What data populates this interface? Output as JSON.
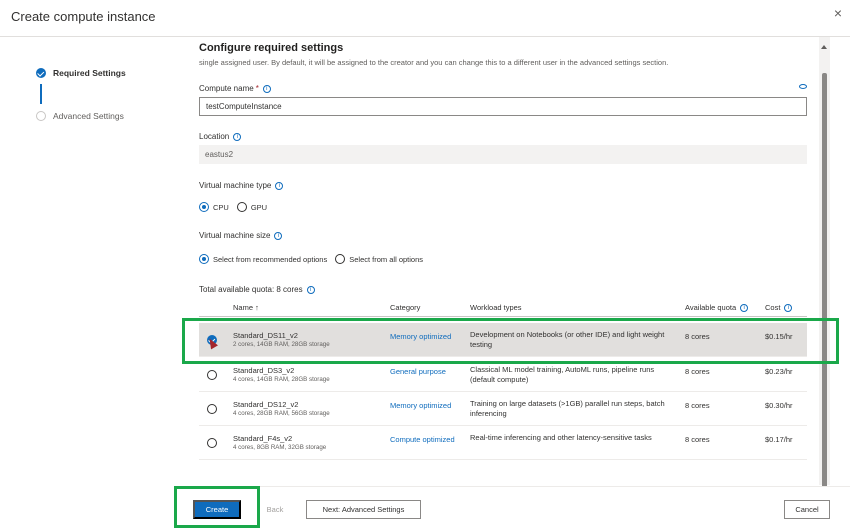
{
  "window": {
    "title": "Create compute instance",
    "close_icon": "×"
  },
  "steps": [
    {
      "label": "Required Settings",
      "state": "done"
    },
    {
      "label": "Advanced Settings",
      "state": "pending"
    }
  ],
  "section": {
    "heading": "Configure required settings",
    "intro": "single assigned user. By default, it will be assigned to the creator and you can change this to a different user in the advanced settings section."
  },
  "compute_name": {
    "label": "Compute name",
    "required_marker": "*",
    "value": "testComputeInstance"
  },
  "location": {
    "label": "Location",
    "value": "eastus2"
  },
  "vm_type": {
    "label": "Virtual machine type",
    "options": [
      {
        "label": "CPU",
        "selected": true
      },
      {
        "label": "GPU",
        "selected": false
      }
    ]
  },
  "vm_size": {
    "label": "Virtual machine size",
    "options": [
      {
        "label": "Select from recommended options",
        "selected": true
      },
      {
        "label": "Select from all options",
        "selected": false
      }
    ]
  },
  "quota": {
    "label": "Total available quota: 8 cores"
  },
  "table": {
    "headers": {
      "name": "Name ↑",
      "category": "Category",
      "workload": "Workload types",
      "quota": "Available quota",
      "cost": "Cost"
    },
    "rows": [
      {
        "name": "Standard_DS11_v2",
        "specs": "2 cores, 14GB RAM, 28GB storage",
        "category": "Memory optimized",
        "workload": "Development on Notebooks (or other IDE) and light weight testing",
        "quota": "8 cores",
        "cost": "$0.15/hr",
        "selected": true
      },
      {
        "name": "Standard_DS3_v2",
        "specs": "4 cores, 14GB RAM, 28GB storage",
        "category": "General purpose",
        "workload": "Classical ML model training, AutoML runs, pipeline runs (default compute)",
        "quota": "8 cores",
        "cost": "$0.23/hr",
        "selected": false
      },
      {
        "name": "Standard_DS12_v2",
        "specs": "4 cores, 28GB RAM, 56GB storage",
        "category": "Memory optimized",
        "workload": "Training on large datasets (>1GB) parallel run steps, batch inferencing",
        "quota": "8 cores",
        "cost": "$0.30/hr",
        "selected": false
      },
      {
        "name": "Standard_F4s_v2",
        "specs": "4 cores, 8GB RAM, 32GB storage",
        "category": "Compute optimized",
        "workload": "Real-time inferencing and other latency-sensitive tasks",
        "quota": "8 cores",
        "cost": "$0.17/hr",
        "selected": false
      }
    ]
  },
  "footer": {
    "create": "Create",
    "back": "Back",
    "next": "Next: Advanced Settings",
    "cancel": "Cancel"
  },
  "colors": {
    "accent": "#0f6cbd",
    "highlight": "#1aa84a",
    "selected_row": "#e1dfdd"
  }
}
